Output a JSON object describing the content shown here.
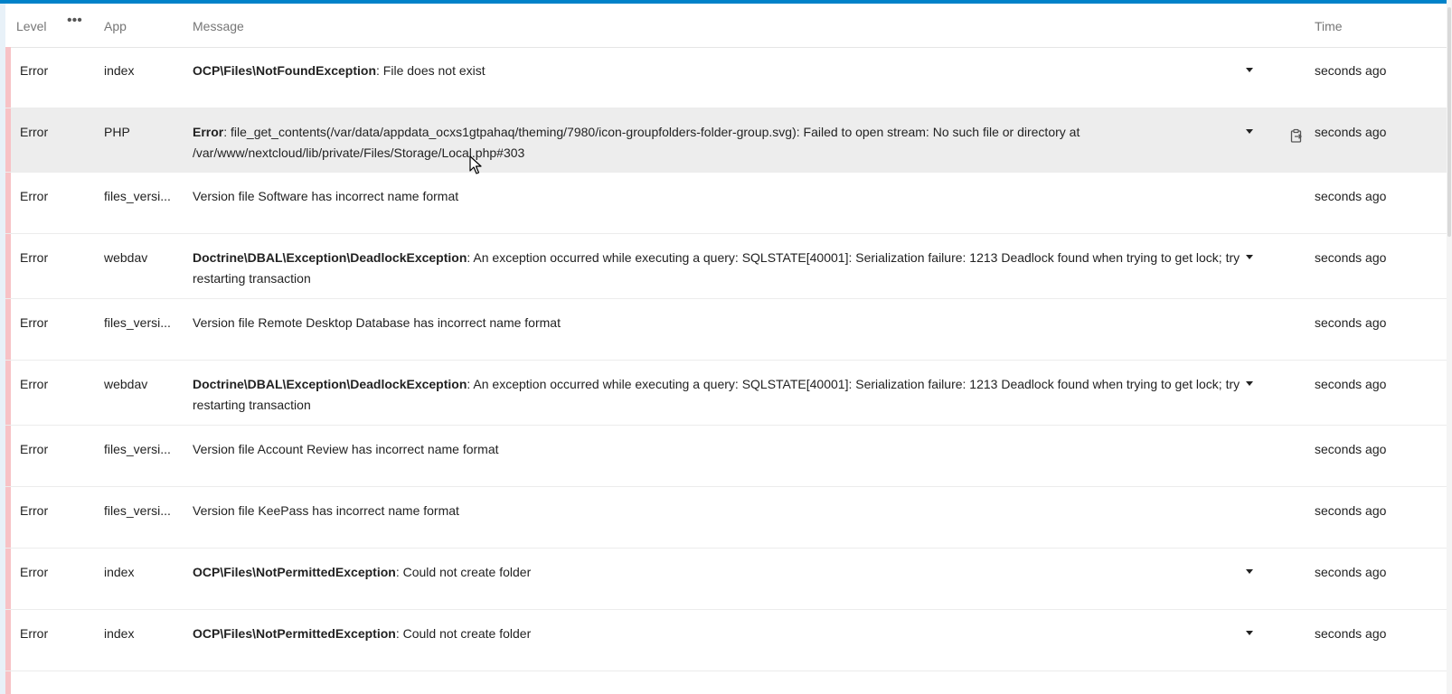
{
  "header": {
    "level": "Level",
    "app": "App",
    "message": "Message",
    "time": "Time",
    "menu": "•••"
  },
  "colors": {
    "accent": "#0082c9",
    "error_bar": "#f7c2c6",
    "hover_row": "#ededed"
  },
  "icons": {
    "menu": "more-dots-icon",
    "expand": "caret-down-icon",
    "copy": "clipboard-copy-icon",
    "cursor": "mouse-pointer-icon"
  },
  "rows": [
    {
      "level": "Error",
      "app": "index",
      "exception": "OCP\\Files\\NotFoundException",
      "message": ": File does not exist",
      "time": "seconds ago"
    },
    {
      "level": "Error",
      "app": "PHP",
      "exception": "Error",
      "message": ": file_get_contents(/var/data/appdata_ocxs1gtpahaq/theming/7980/icon-groupfolders-folder-group.svg): Failed to open stream: No such file or directory at /var/www/nextcloud/lib/private/Files/Storage/Local.php#303",
      "time": "seconds ago"
    },
    {
      "level": "Error",
      "app": "files_versi...",
      "exception": "",
      "message": "Version file Software has incorrect name format",
      "time": "seconds ago"
    },
    {
      "level": "Error",
      "app": "webdav",
      "exception": "Doctrine\\DBAL\\Exception\\DeadlockException",
      "message": ": An exception occurred while executing a query: SQLSTATE[40001]: Serialization failure: 1213 Deadlock found when trying to get lock; try restarting transaction",
      "time": "seconds ago"
    },
    {
      "level": "Error",
      "app": "files_versi...",
      "exception": "",
      "message": "Version file Remote Desktop Database has incorrect name format",
      "time": "seconds ago"
    },
    {
      "level": "Error",
      "app": "webdav",
      "exception": "Doctrine\\DBAL\\Exception\\DeadlockException",
      "message": ": An exception occurred while executing a query: SQLSTATE[40001]: Serialization failure: 1213 Deadlock found when trying to get lock; try restarting transaction",
      "time": "seconds ago"
    },
    {
      "level": "Error",
      "app": "files_versi...",
      "exception": "",
      "message": "Version file Account Review has incorrect name format",
      "time": "seconds ago"
    },
    {
      "level": "Error",
      "app": "files_versi...",
      "exception": "",
      "message": "Version file KeePass has incorrect name format",
      "time": "seconds ago"
    },
    {
      "level": "Error",
      "app": "index",
      "exception": "OCP\\Files\\NotPermittedException",
      "message": ": Could not create folder",
      "time": "seconds ago"
    },
    {
      "level": "Error",
      "app": "index",
      "exception": "OCP\\Files\\NotPermittedException",
      "message": ": Could not create folder",
      "time": "seconds ago"
    }
  ]
}
